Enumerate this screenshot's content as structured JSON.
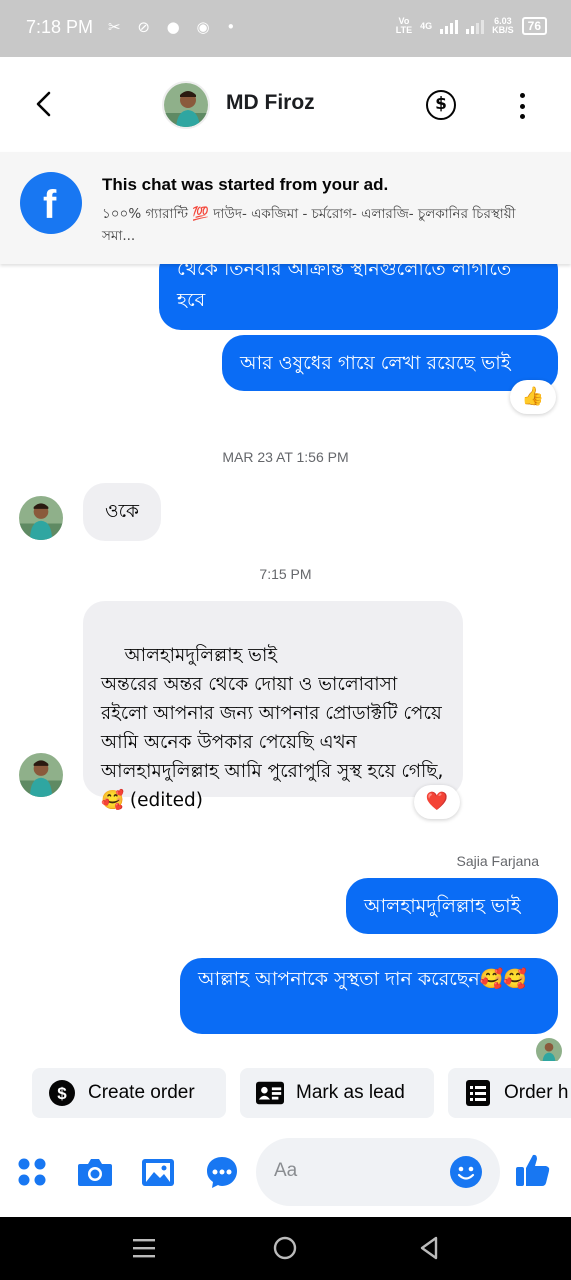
{
  "status_bar": {
    "time": "7:18 PM",
    "notification_icons": "✂ ⊘ ● ◉ •",
    "network_top": "Vo",
    "network_bottom": "LTE",
    "net_type": "4G",
    "speed_value": "6.03",
    "speed_unit": "KB/S",
    "battery": "76"
  },
  "header": {
    "contact_name": "MD Firoz",
    "back_icon": "back-arrow-icon",
    "payment_icon": "dollar-icon",
    "more_icon": "more-vertical-icon",
    "dollar_glyph": "$"
  },
  "ad_banner": {
    "title": "This chat was started from your ad.",
    "subtitle": "১০০% গ্যারান্টি 💯 দাউদ- একজিমা - চর্মরোগ-  এলারজি- চুলকানির চিরস্থায়ী সমা...",
    "icon": "facebook-icon",
    "icon_glyph": "f"
  },
  "messages": {
    "out_1": "থেকে তিনবার আক্রান্ত স্থানগুলোতে লাগাতে হবে",
    "out_2": "আর ওষুধের গায়ে লেখা রয়েছে ভাই",
    "out_2_reaction": "👍",
    "timestamp_1": "MAR 23 AT 1:56 PM",
    "in_1": "ওকে",
    "timestamp_2": "7:15 PM",
    "in_2": "আলহামদুলিল্লাহ ভাই\nঅন্তরের অন্তর থেকে দোয়া ও ভালোবাসা রইলো আপনার জন্য আপনার প্রোডাক্টটি পেয়ে আমি অনেক উপকার পেয়েছি এখন আলহামদুলিল্লাহ আমি পুরোপুরি সুস্থ হয়ে গেছি,🥰 (edited)",
    "in_2_reaction": "❤️",
    "sender_name": "Sajia Farjana",
    "out_3": "আলহামদুলিল্লাহ ভাই",
    "out_4": "আল্লাহ আপনাকে সুস্থতা দান করেছেন🥰🥰"
  },
  "quick_actions": [
    {
      "label": "Create order",
      "icon": "dollar-circle-icon"
    },
    {
      "label": "Mark as lead",
      "icon": "id-card-icon"
    },
    {
      "label": "Order h",
      "icon": "receipt-icon"
    }
  ],
  "composer": {
    "placeholder": "Aa",
    "icons": [
      "menu-dots-icon",
      "camera-icon",
      "gallery-icon",
      "chat-bubble-icon",
      "emoji-icon",
      "thumbs-up-icon"
    ]
  },
  "navbar": {
    "icons": [
      "recent-apps-icon",
      "home-icon",
      "back-icon"
    ]
  },
  "colors": {
    "accent": "#1877f2",
    "outgoing_bubble": "#0a6cf5",
    "incoming_bubble": "#efeff2"
  }
}
